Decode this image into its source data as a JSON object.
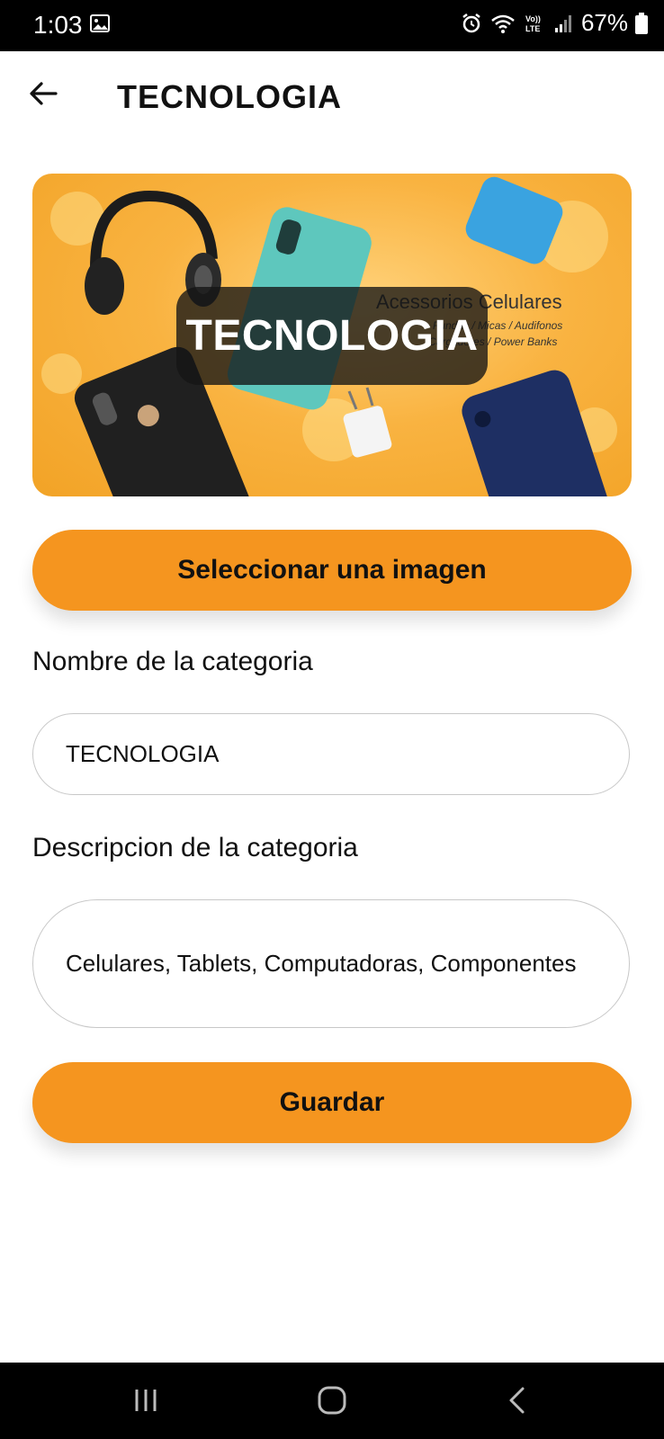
{
  "status_bar": {
    "time": "1:03",
    "battery": "67%",
    "icons": [
      "gallery-icon",
      "alarm-icon",
      "wifi-icon",
      "volte-icon",
      "signal-icon",
      "battery-icon"
    ]
  },
  "app_bar": {
    "back_icon": "arrow-left-icon",
    "title": "TECNOLOGIA"
  },
  "banner": {
    "overlay_text": "TECNOLOGIA",
    "promo_title": "Acessorios Celulares",
    "promo_line1": "Fundas / Micas / Audifonos",
    "promo_line2": "Cargadores / Power Banks"
  },
  "select_image_button": {
    "label": "Seleccionar una imagen"
  },
  "name_field": {
    "label": "Nombre de la categoria",
    "value": "TECNOLOGIA"
  },
  "description_field": {
    "label": "Descripcion de la categoria",
    "value": "Celulares, Tablets, Computadoras, Componentes"
  },
  "save_button": {
    "label": "Guardar"
  },
  "nav_bar": {
    "icons": [
      "recent-apps-icon",
      "home-icon",
      "back-nav-icon"
    ]
  },
  "colors": {
    "accent": "#f5951f",
    "banner_background": "#f9b341",
    "overlay": "#141414"
  }
}
